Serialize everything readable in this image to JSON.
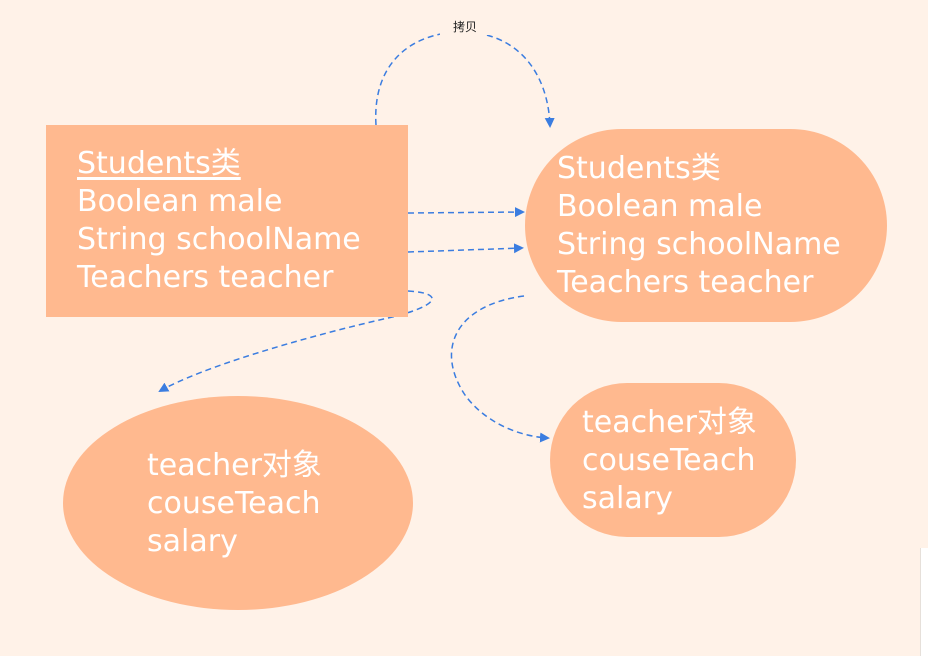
{
  "diagram": {
    "copy_label": "拷贝",
    "source_class": {
      "lines": [
        "Students类",
        "Boolean male",
        "String schoolName",
        "Teachers teacher"
      ]
    },
    "copied_class": {
      "lines": [
        "Students类",
        "Boolean male",
        "String schoolName",
        "Teachers teacher"
      ]
    },
    "source_teacher": {
      "lines": [
        "teacher对象",
        "couseTeach",
        "salary"
      ]
    },
    "copied_teacher": {
      "lines": [
        "teacher对象",
        "couseTeach",
        "salary"
      ]
    },
    "colors": {
      "node_fill": "#ffb98f",
      "node_text": "#ffffff",
      "arrow": "#3b7de0",
      "background": "#fff2e8"
    }
  }
}
